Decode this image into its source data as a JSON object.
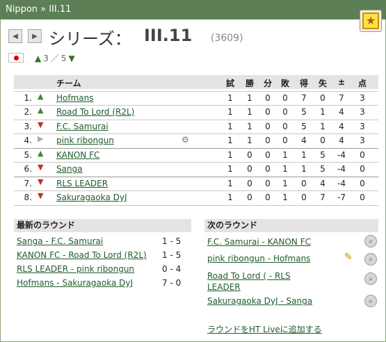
{
  "header": {
    "breadcrumb": "Nippon » III.11"
  },
  "favorite_icon": "favorite-star-icon",
  "title": {
    "series_label": "シリーズ：",
    "league_name": "III.11",
    "league_id": "(3609)"
  },
  "nav": {
    "prev_icon": "prev-arrow-icon",
    "next_icon": "next-arrow-icon"
  },
  "level": {
    "flag": "japan-flag-icon",
    "current": "3",
    "separator": "／",
    "total": "5"
  },
  "table": {
    "headers": [
      "チーム",
      "試",
      "勝",
      "分",
      "敗",
      "得",
      "失",
      "±",
      "点"
    ],
    "rows": [
      {
        "pos": "1.",
        "trend": "up",
        "team": "Hofmans",
        "played": "1",
        "won": "1",
        "draw": "0",
        "lost": "0",
        "gf": "7",
        "ga": "0",
        "diff": "7",
        "pts": "3"
      },
      {
        "pos": "2.",
        "trend": "up",
        "team": "Road To Lord (R2L)",
        "played": "1",
        "won": "1",
        "draw": "0",
        "lost": "0",
        "gf": "5",
        "ga": "1",
        "diff": "4",
        "pts": "3"
      },
      {
        "pos": "3.",
        "trend": "down",
        "team": "F.C. Samurai",
        "played": "1",
        "won": "1",
        "draw": "0",
        "lost": "0",
        "gf": "5",
        "ga": "1",
        "diff": "4",
        "pts": "3"
      },
      {
        "pos": "4.",
        "trend": "same",
        "team": "pink ribongun",
        "played": "1",
        "won": "1",
        "draw": "0",
        "lost": "0",
        "gf": "4",
        "ga": "0",
        "diff": "4",
        "pts": "3"
      },
      {
        "pos": "5.",
        "trend": "up",
        "team": "KANON FC",
        "played": "1",
        "won": "0",
        "draw": "0",
        "lost": "1",
        "gf": "1",
        "ga": "5",
        "diff": "-4",
        "pts": "0"
      },
      {
        "pos": "6.",
        "trend": "down",
        "team": "Sanga",
        "played": "1",
        "won": "0",
        "draw": "0",
        "lost": "1",
        "gf": "1",
        "ga": "5",
        "diff": "-4",
        "pts": "0"
      },
      {
        "pos": "7.",
        "trend": "down",
        "team": "RLS LEADER",
        "played": "1",
        "won": "0",
        "draw": "0",
        "lost": "1",
        "gf": "0",
        "ga": "4",
        "diff": "-4",
        "pts": "0"
      },
      {
        "pos": "8.",
        "trend": "down",
        "team": "Sakuragaoka DyJ",
        "played": "1",
        "won": "0",
        "draw": "0",
        "lost": "1",
        "gf": "0",
        "ga": "7",
        "diff": "-7",
        "pts": "0"
      }
    ]
  },
  "latest_round": {
    "title": "最新のラウンド",
    "matches": [
      {
        "teams": "Sanga - F.C. Samurai",
        "score": "1 - 5"
      },
      {
        "teams": "KANON FC - Road To Lord (R2L)",
        "score": "1 - 5"
      },
      {
        "teams": "RLS LEADER - pink ribongun",
        "score": "0 - 4"
      },
      {
        "teams": "Hofmans - Sakuragaoka DyJ",
        "score": "7 - 0"
      }
    ]
  },
  "next_round": {
    "title": "次のラウンド",
    "matches": [
      {
        "teams": "F.C. Samurai - KANON FC"
      },
      {
        "teams": "pink ribongun - Hofmans"
      },
      {
        "teams": "Road To Lord ( - RLS LEADER"
      },
      {
        "teams": "Sakuragaoka DyJ - Sanga"
      }
    ],
    "add_live": "ラウンドをHT Liveに追加する"
  },
  "colors": {
    "header_bar": "#5d7f55",
    "link": "#1e5b2a",
    "trend_up": "#3a8a2a",
    "trend_down": "#b8322a",
    "trend_same": "#aaaaaa"
  }
}
